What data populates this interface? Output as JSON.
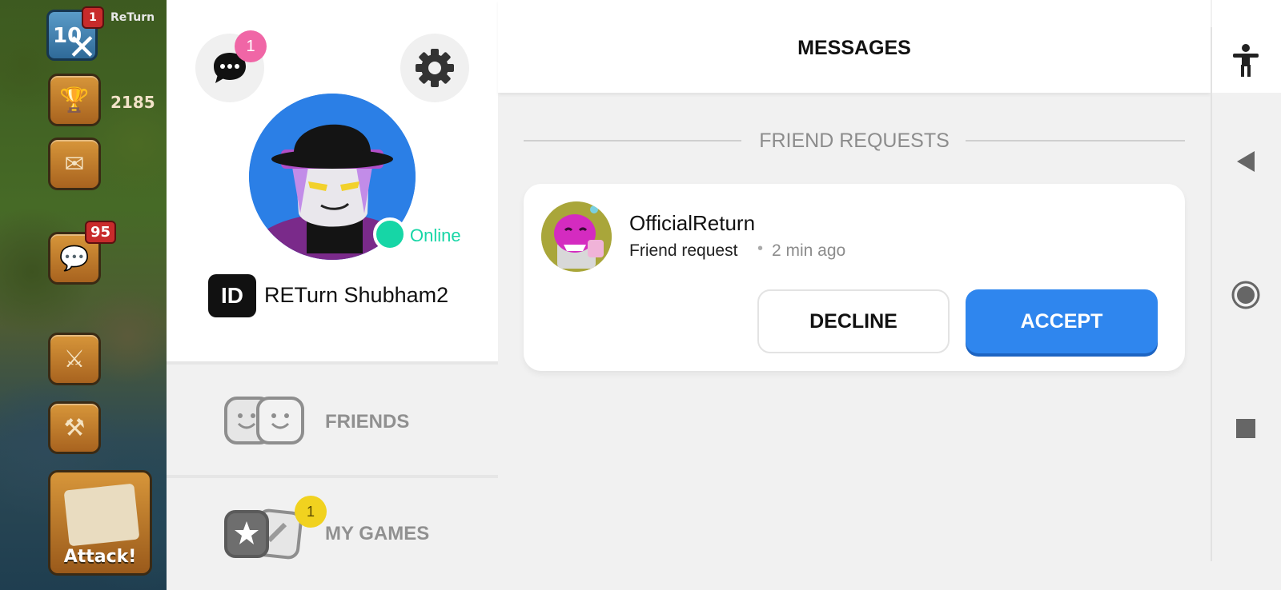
{
  "game": {
    "level": "10",
    "level_badge": "1",
    "player_name": "ReTurn",
    "trophies": "2185",
    "chat_badge": "95",
    "attack_label": "Attack!"
  },
  "profile": {
    "chat_badge": "1",
    "status": "Online",
    "id_badge": "ID",
    "username": "RETurn Shubham2",
    "menu": [
      {
        "label": "FRIENDS",
        "icon": "friends-faces-icon"
      },
      {
        "label": "MY GAMES",
        "icon": "games-cards-icon",
        "badge": "1"
      }
    ]
  },
  "messages": {
    "title": "MESSAGES",
    "section_title": "FRIEND REQUESTS",
    "request": {
      "name": "OfficialReturn",
      "type": "Friend request",
      "separator": "•",
      "time": "2 min ago",
      "decline_label": "DECLINE",
      "accept_label": "ACCEPT"
    }
  },
  "system_bar": {
    "icons": [
      "accessibility-icon",
      "back-icon",
      "home-icon",
      "recents-icon"
    ]
  },
  "colors": {
    "accent_blue": "#2f86ee",
    "online_green": "#16d6a6",
    "badge_pink": "#f066a6",
    "badge_yellow": "#f1d21f"
  }
}
